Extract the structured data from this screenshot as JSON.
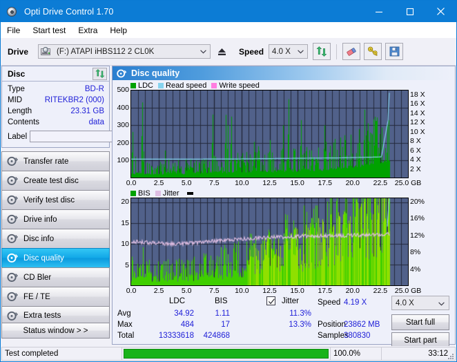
{
  "window": {
    "title": "Opti Drive Control 1.70",
    "icon": "disc-icon",
    "minimize": "minimize",
    "maximize": "maximize",
    "close": "close"
  },
  "menu": {
    "items": [
      {
        "label": "File"
      },
      {
        "label": "Start test"
      },
      {
        "label": "Extra"
      },
      {
        "label": "Help"
      }
    ]
  },
  "toolbar": {
    "drive_label": "Drive",
    "drive_value": "(F:)  ATAPI iHBS112  2 CL0K",
    "eject_icon": "eject-icon",
    "speed_label": "Speed",
    "speed_value": "4.0 X",
    "refresh_icon": "refresh-icon",
    "erase_icon": "eraser-icon",
    "tools_icon": "tools-icon",
    "save_icon": "save-icon"
  },
  "sidebar": {
    "disc_panel": {
      "title": "Disc",
      "refresh_icon": "refresh-icon",
      "rows": [
        {
          "key": "Type",
          "value": "BD-R"
        },
        {
          "key": "MID",
          "value": "RITEKBR2 (000)"
        },
        {
          "key": "Length",
          "value": "23.31 GB"
        },
        {
          "key": "Contents",
          "value": "data"
        }
      ],
      "label_key": "Label",
      "label_value": "",
      "label_placeholder": "",
      "label_button_icon": "disc-icon"
    },
    "nav": [
      {
        "label": "Transfer rate",
        "icon": "disc-test-icon",
        "active": false
      },
      {
        "label": "Create test disc",
        "icon": "disc-test-icon",
        "active": false
      },
      {
        "label": "Verify test disc",
        "icon": "disc-test-icon",
        "active": false
      },
      {
        "label": "Drive info",
        "icon": "disc-test-icon",
        "active": false
      },
      {
        "label": "Disc info",
        "icon": "disc-test-icon",
        "active": false
      },
      {
        "label": "Disc quality",
        "icon": "disc-test-icon",
        "active": true
      },
      {
        "label": "CD Bler",
        "icon": "disc-test-icon",
        "active": false
      },
      {
        "label": "FE / TE",
        "icon": "disc-test-icon",
        "active": false
      },
      {
        "label": "Extra tests",
        "icon": "disc-test-icon",
        "active": false
      }
    ],
    "status_window_button": "Status window > >"
  },
  "main": {
    "title": "Disc quality",
    "icon": "disc-quality-icon"
  },
  "stats": {
    "col_ldc": "LDC",
    "col_bis": "BIS",
    "jitter_label": "Jitter",
    "jitter_checked": true,
    "rows": [
      {
        "key": "Avg",
        "ldc": "34.92",
        "bis": "1.11",
        "jitter": "11.3%"
      },
      {
        "key": "Max",
        "ldc": "484",
        "bis": "17",
        "jitter": "13.3%"
      },
      {
        "key": "Total",
        "ldc": "13333618",
        "bis": "424868",
        "jitter": ""
      }
    ],
    "speed_key": "Speed",
    "speed_value": "4.19 X",
    "position_key": "Position",
    "position_value": "23862 MB",
    "samples_key": "Samples",
    "samples_value": "380830",
    "speed_select": "4.0 X",
    "start_full": "Start full",
    "start_part": "Start part"
  },
  "statusbar": {
    "message": "Test completed",
    "percent": "100.0%",
    "progress": 100,
    "elapsed": "33:12"
  },
  "colors": {
    "accent": "#0c7cd5",
    "plot_bg": "#51618a",
    "ldc": "#00a200",
    "bis": "#00a200",
    "read_speed": "#86d3ef",
    "write_speed": "#ff7ee0",
    "jitter": "#debde2",
    "value_text": "#2020d8",
    "progress": "#19b319"
  },
  "chart_data": [
    {
      "type": "area",
      "title": "LDC / Read speed",
      "xlabel": "GB",
      "ylabel": "LDC",
      "xlim": [
        0,
        25
      ],
      "ylim": [
        0,
        500
      ],
      "xticks": [
        "0.0",
        "2.5",
        "5.0",
        "7.5",
        "10.0",
        "12.5",
        "15.0",
        "17.5",
        "20.0",
        "22.5",
        "25.0 GB"
      ],
      "yticks_left": [
        100,
        200,
        300,
        400,
        500
      ],
      "yticks_right": [
        "2 X",
        "4 X",
        "6 X",
        "8 X",
        "10 X",
        "12 X",
        "14 X",
        "16 X",
        "18 X"
      ],
      "y2lim": [
        0,
        19
      ],
      "grid": true,
      "legend": [
        {
          "name": "LDC",
          "color": "#00a200"
        },
        {
          "name": "Read speed",
          "color": "#86d3ef"
        },
        {
          "name": "Write speed",
          "color": "#ff7ee0"
        }
      ],
      "data_end_gb": 23.31,
      "series": [
        {
          "name": "LDC",
          "type": "area",
          "color": "#00a200",
          "baseline_x": [
            0,
            2,
            4,
            6,
            8,
            10,
            12,
            14,
            16,
            18,
            20,
            22,
            23.3
          ],
          "baseline_y": [
            22,
            20,
            22,
            26,
            30,
            32,
            34,
            36,
            40,
            46,
            58,
            78,
            95
          ],
          "noise_amp": 16,
          "spikes": [
            {
              "x": 0.15,
              "y": 262
            },
            {
              "x": 0.35,
              "y": 120
            },
            {
              "x": 1.02,
              "y": 432
            },
            {
              "x": 1.1,
              "y": 150
            },
            {
              "x": 3.05,
              "y": 155
            },
            {
              "x": 3.35,
              "y": 105
            },
            {
              "x": 7.35,
              "y": 362
            },
            {
              "x": 8.55,
              "y": 360
            },
            {
              "x": 8.75,
              "y": 300
            },
            {
              "x": 9.05,
              "y": 350
            },
            {
              "x": 10.05,
              "y": 140
            },
            {
              "x": 11.1,
              "y": 205
            },
            {
              "x": 11.45,
              "y": 180
            },
            {
              "x": 12.55,
              "y": 215
            },
            {
              "x": 13.7,
              "y": 300
            },
            {
              "x": 14.2,
              "y": 450
            },
            {
              "x": 15.35,
              "y": 330
            },
            {
              "x": 17.45,
              "y": 300
            },
            {
              "x": 18.9,
              "y": 230
            },
            {
              "x": 19.35,
              "y": 215
            },
            {
              "x": 20.55,
              "y": 190
            },
            {
              "x": 21.1,
              "y": 390
            },
            {
              "x": 22.2,
              "y": 345
            },
            {
              "x": 22.45,
              "y": 250
            },
            {
              "x": 22.95,
              "y": 170
            },
            {
              "x": 23.15,
              "y": 260
            }
          ]
        },
        {
          "name": "Read speed",
          "type": "line",
          "color": "#86d3ef",
          "axis": "right",
          "x": [
            0,
            1,
            3,
            5,
            7,
            9,
            11,
            13,
            15,
            17,
            19,
            21,
            22.6,
            23.2,
            23.3
          ],
          "y": [
            4.0,
            4.0,
            4.0,
            4.0,
            4.05,
            4.05,
            4.1,
            4.15,
            4.2,
            4.25,
            4.3,
            4.4,
            4.5,
            12.5,
            18.5
          ]
        }
      ]
    },
    {
      "type": "area",
      "title": "BIS / Jitter",
      "xlabel": "GB",
      "ylabel": "BIS",
      "xlim": [
        0,
        25
      ],
      "ylim": [
        0,
        21
      ],
      "xticks": [
        "0.0",
        "2.5",
        "5.0",
        "7.5",
        "10.0",
        "12.5",
        "15.0",
        "17.5",
        "20.0",
        "22.5",
        "25.0 GB"
      ],
      "yticks_left": [
        5,
        10,
        15,
        20
      ],
      "yticks_right": [
        "4%",
        "8%",
        "12%",
        "16%",
        "20%"
      ],
      "y2lim": [
        0,
        21
      ],
      "grid": true,
      "legend": [
        {
          "name": "BIS",
          "color": "#00a200"
        },
        {
          "name": "Jitter",
          "color": "#debde2"
        }
      ],
      "data_end_gb": 23.31,
      "series": [
        {
          "name": "BIS",
          "type": "area",
          "color": "#3fcf00",
          "baseline_x": [
            0,
            2,
            4,
            6,
            8,
            10,
            12,
            14,
            16,
            18,
            20,
            22,
            23.3
          ],
          "baseline_y": [
            1.6,
            1.3,
            1.4,
            1.6,
            2.0,
            2.6,
            3.3,
            3.8,
            4.3,
            4.8,
            5.6,
            7.0,
            9.0
          ],
          "noise_amp": 2.2,
          "spikes": [
            {
              "x": 0.12,
              "y": 6.0
            },
            {
              "x": 0.55,
              "y": 5.2
            },
            {
              "x": 1.05,
              "y": 9.2
            },
            {
              "x": 4.65,
              "y": 5.0
            },
            {
              "x": 6.15,
              "y": 5.2
            },
            {
              "x": 8.35,
              "y": 8.6
            },
            {
              "x": 8.55,
              "y": 9.0
            },
            {
              "x": 10.65,
              "y": 9.0
            },
            {
              "x": 11.05,
              "y": 10.2
            },
            {
              "x": 12.3,
              "y": 9.2
            },
            {
              "x": 14.1,
              "y": 9.6
            },
            {
              "x": 16.2,
              "y": 9.0
            },
            {
              "x": 18.45,
              "y": 9.5
            },
            {
              "x": 20.55,
              "y": 10.5
            },
            {
              "x": 21.6,
              "y": 12.0
            },
            {
              "x": 22.4,
              "y": 11.5
            },
            {
              "x": 22.95,
              "y": 13.5
            },
            {
              "x": 23.2,
              "y": 17.0
            }
          ]
        },
        {
          "name": "Jitter",
          "type": "line",
          "color": "#debde2",
          "axis": "right",
          "x": [
            0,
            1,
            2,
            3,
            4,
            5,
            6,
            7,
            8,
            9,
            10,
            11,
            12,
            13,
            14,
            15,
            16,
            17,
            18,
            19,
            20,
            21,
            22,
            23,
            23.3
          ],
          "y": [
            10.6,
            10.4,
            10.2,
            10.1,
            10.0,
            10.1,
            10.3,
            10.5,
            10.8,
            11.0,
            11.2,
            11.4,
            11.5,
            11.6,
            11.7,
            11.8,
            11.9,
            11.9,
            12.0,
            12.0,
            12.1,
            12.1,
            12.2,
            12.3,
            12.3
          ],
          "noise_amp": 0.45
        },
        {
          "name": "Read speed",
          "type": "line",
          "color": "#86d3ef",
          "axis": "right",
          "x": [
            23.1,
            23.25,
            23.31
          ],
          "y": [
            13.0,
            19.0,
            21.0
          ]
        }
      ]
    }
  ]
}
